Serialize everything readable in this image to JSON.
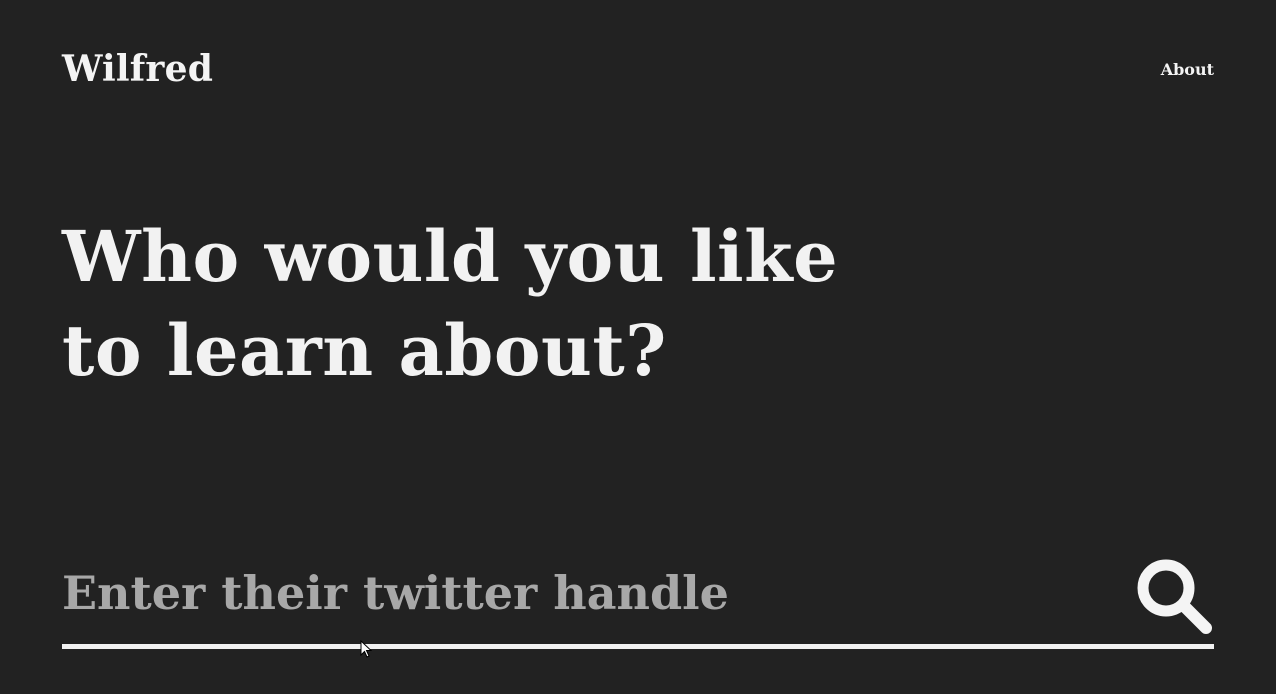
{
  "header": {
    "brand": "Wilfred",
    "nav_about": "About"
  },
  "main": {
    "headline": "Who would you like to learn about?"
  },
  "search": {
    "placeholder": "Enter their twitter handle",
    "value": "",
    "icon": "search-icon"
  },
  "colors": {
    "background": "#222222",
    "text": "#f2f2f2",
    "placeholder": "#a8a8a8"
  }
}
